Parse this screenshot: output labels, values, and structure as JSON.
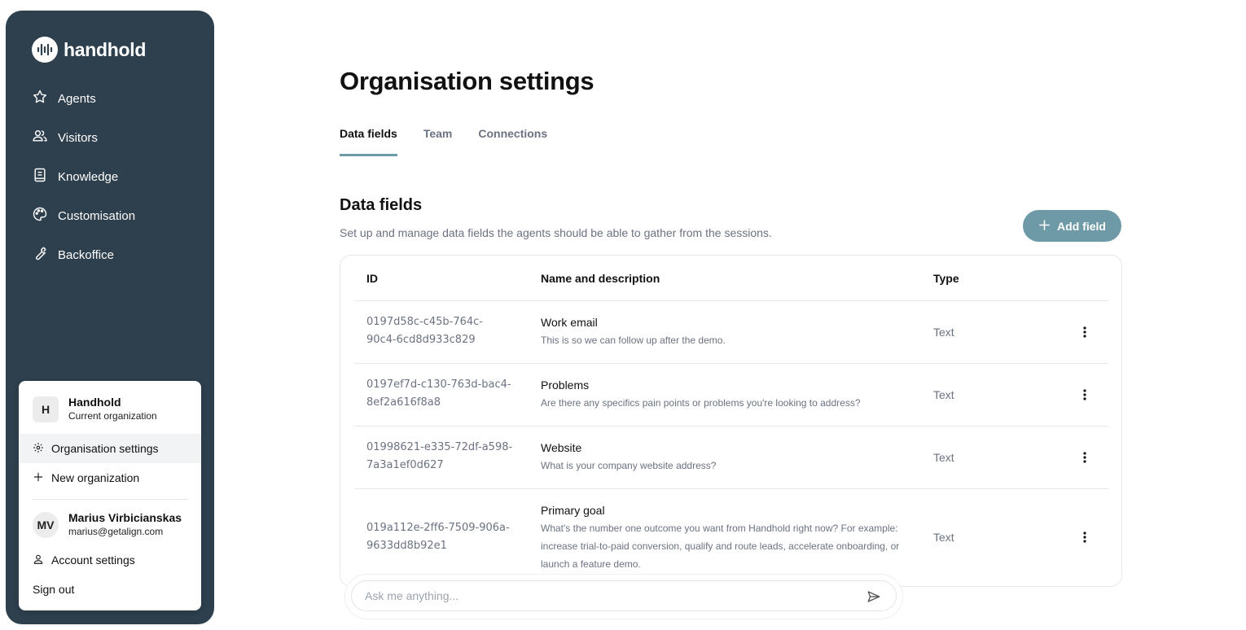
{
  "brand": {
    "name": "handhold"
  },
  "nav": {
    "items": [
      {
        "label": "Agents",
        "icon": "star-icon"
      },
      {
        "label": "Visitors",
        "icon": "users-icon"
      },
      {
        "label": "Knowledge",
        "icon": "book-icon"
      },
      {
        "label": "Customisation",
        "icon": "palette-icon"
      },
      {
        "label": "Backoffice",
        "icon": "wrench-icon"
      }
    ]
  },
  "org_menu": {
    "org_initial": "H",
    "org_name": "Handhold",
    "org_subtitle": "Current organization",
    "settings_label": "Organisation settings",
    "new_org_label": "New organization",
    "user_initials": "MV",
    "user_name": "Marius Virbicianskas",
    "user_email": "marius@getalign.com",
    "account_label": "Account settings",
    "signout_label": "Sign out"
  },
  "page": {
    "title": "Organisation settings",
    "tabs": [
      {
        "label": "Data fields",
        "active": true
      },
      {
        "label": "Team",
        "active": false
      },
      {
        "label": "Connections",
        "active": false
      }
    ]
  },
  "section": {
    "title": "Data fields",
    "description": "Set up and manage data fields the agents should be able to gather from the sessions.",
    "add_button": "Add field"
  },
  "table": {
    "headers": {
      "id": "ID",
      "name": "Name and description",
      "type": "Type"
    },
    "rows": [
      {
        "id_line1": "0197d58c-c45b-764c-",
        "id_line2": "90c4-6cd8d933c829",
        "name": "Work email",
        "description": "This is so we can follow up after the demo.",
        "type": "Text"
      },
      {
        "id_line1": "0197ef7d-c130-763d-bac4-",
        "id_line2": "8ef2a616f8a8",
        "name": "Problems",
        "description": "Are there any specifics pain points or problems you're looking to address?",
        "type": "Text"
      },
      {
        "id_line1": "01998621-e335-72df-a598-",
        "id_line2": "7a3a1ef0d627",
        "name": "Website",
        "description": "What is your company website address?",
        "type": "Text"
      },
      {
        "id_line1": "019a112e-2ff6-7509-906a-",
        "id_line2": "9633dd8b92e1",
        "name": "Primary goal",
        "description": "What's the number one outcome you want from Handhold right now? For example: increase trial-to-paid conversion, qualify and route leads, accelerate onboarding, or launch a feature demo.",
        "type": "Text"
      }
    ]
  },
  "chat": {
    "placeholder": "Ask me anything..."
  },
  "colors": {
    "sidebar": "#2e3f4d",
    "accent": "#6e9aa8",
    "muted_text": "#6b7280"
  }
}
